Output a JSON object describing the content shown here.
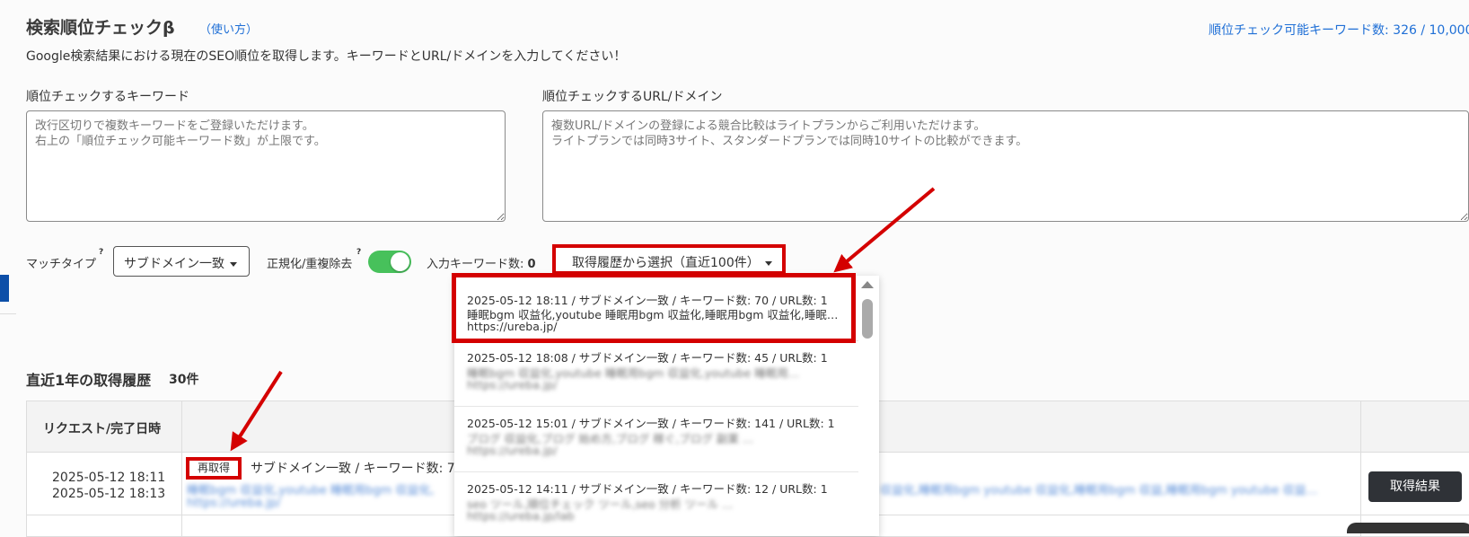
{
  "header": {
    "title": "検索順位チェックβ",
    "howto_link": "（使い方）",
    "quota": "順位チェック可能キーワード数: 326 / 10,000",
    "description": "Google検索結果における現在のSEO順位を取得します。キーワードとURL/ドメインを入力してください！"
  },
  "keyword_field": {
    "label": "順位チェックするキーワード",
    "placeholder": "改行区切りで複数キーワードをご登録いただけます。\n右上の「順位チェック可能キーワード数」が上限です。"
  },
  "url_field": {
    "label": "順位チェックするURL/ドメイン",
    "placeholder": "複数URL/ドメインの登録による競合比較はライトプランからご利用いただけます。\nライトプランでは同時3サイト、スタンダードプランでは同時10サイトの比較ができます。"
  },
  "controls": {
    "match_type_label": "マッチタイプ",
    "match_type_value": "サブドメイン一致",
    "normalize_label": "正規化/重複除去",
    "normalize_on": true,
    "keyword_count_label": "入力キーワード数:",
    "keyword_count": "0",
    "history_button": "取得履歴から選択（直近100件）",
    "help_glyph": "?"
  },
  "history_dropdown": {
    "items": [
      {
        "summary": "2025-05-12 18:11 / サブドメイン一致 / キーワード数: 70 / URL数: 1",
        "keywords": "睡眠bgm 収益化,youtube 睡眠用bgm 収益化,睡眠用bgm 収益化,睡眠…",
        "url": "https://ureba.jp/"
      },
      {
        "summary": "2025-05-12 18:08 / サブドメイン一致 / キーワード数: 45 / URL数: 1"
      },
      {
        "summary": "2025-05-12 15:01 / サブドメイン一致 / キーワード数: 141 / URL数: 1"
      },
      {
        "summary": "2025-05-12 14:11 / サブドメイン一致 / キーワード数: 12 / URL数: 1",
        "url": "https://ureba.jp/lab"
      }
    ]
  },
  "history_section": {
    "title": "直近1年の取得履歴",
    "count": "30件",
    "column_header": "リクエスト/完了日時",
    "row": {
      "request_date": "2025-05-12 18:11",
      "complete_date": "2025-05-12 18:13",
      "refetch_label": "再取得",
      "summary": "サブドメイン一致 / キーワード数: 7",
      "url": "https://ureba.jp/",
      "result_button": "取得結果"
    }
  },
  "colors": {
    "link": "#1f6fd6",
    "highlight": "#d40000",
    "toggle_on": "#47c15b",
    "dark_button": "#2f3237"
  }
}
